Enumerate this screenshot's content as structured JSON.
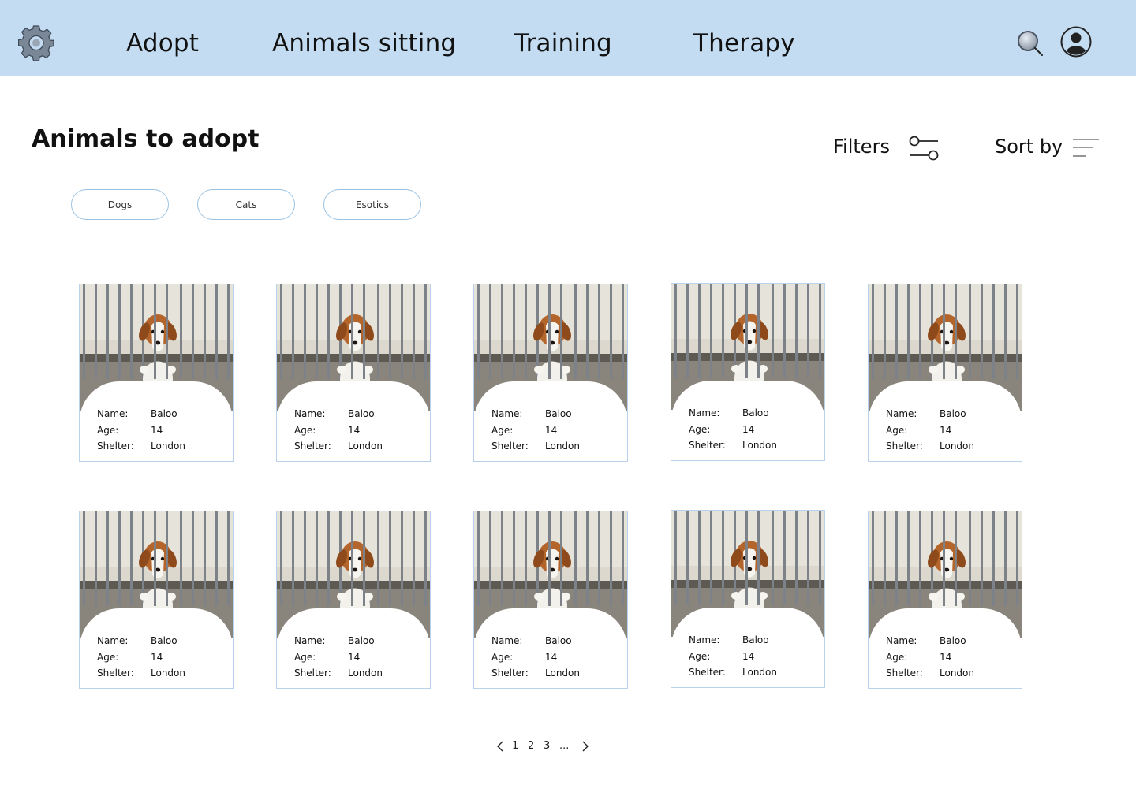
{
  "nav": {
    "items": [
      "Adopt",
      "Animals sitting",
      "Training",
      "Therapy"
    ]
  },
  "header": {
    "title": "Animals to adopt",
    "filters_label": "Filters",
    "sort_label": "Sort by"
  },
  "chips": [
    "Dogs",
    "Cats",
    "Esotics"
  ],
  "card_labels": {
    "name": "Name:",
    "age": "Age:",
    "shelter": "Shelter:"
  },
  "animals": [
    {
      "name": "Baloo",
      "age": "14",
      "shelter": "London"
    },
    {
      "name": "Baloo",
      "age": "14",
      "shelter": "London"
    },
    {
      "name": "Baloo",
      "age": "14",
      "shelter": "London"
    },
    {
      "name": "Baloo",
      "age": "14",
      "shelter": "London"
    },
    {
      "name": "Baloo",
      "age": "14",
      "shelter": "London"
    },
    {
      "name": "Baloo",
      "age": "14",
      "shelter": "London"
    },
    {
      "name": "Baloo",
      "age": "14",
      "shelter": "London"
    },
    {
      "name": "Baloo",
      "age": "14",
      "shelter": "London"
    },
    {
      "name": "Baloo",
      "age": "14",
      "shelter": "London"
    },
    {
      "name": "Baloo",
      "age": "14",
      "shelter": "London"
    }
  ],
  "pagination": {
    "pages": [
      "1",
      "2",
      "3",
      "..."
    ]
  },
  "icons": {
    "settings": "gear-icon",
    "search": "search-icon",
    "account": "user-icon",
    "filters": "sliders-icon",
    "sort": "sort-lines-icon",
    "prev": "chevron-left-icon",
    "next": "chevron-right-icon"
  },
  "colors": {
    "topbar": "#c3dcf2",
    "chip_border": "#9cc3e3",
    "card_border": "#b7d2ea"
  }
}
